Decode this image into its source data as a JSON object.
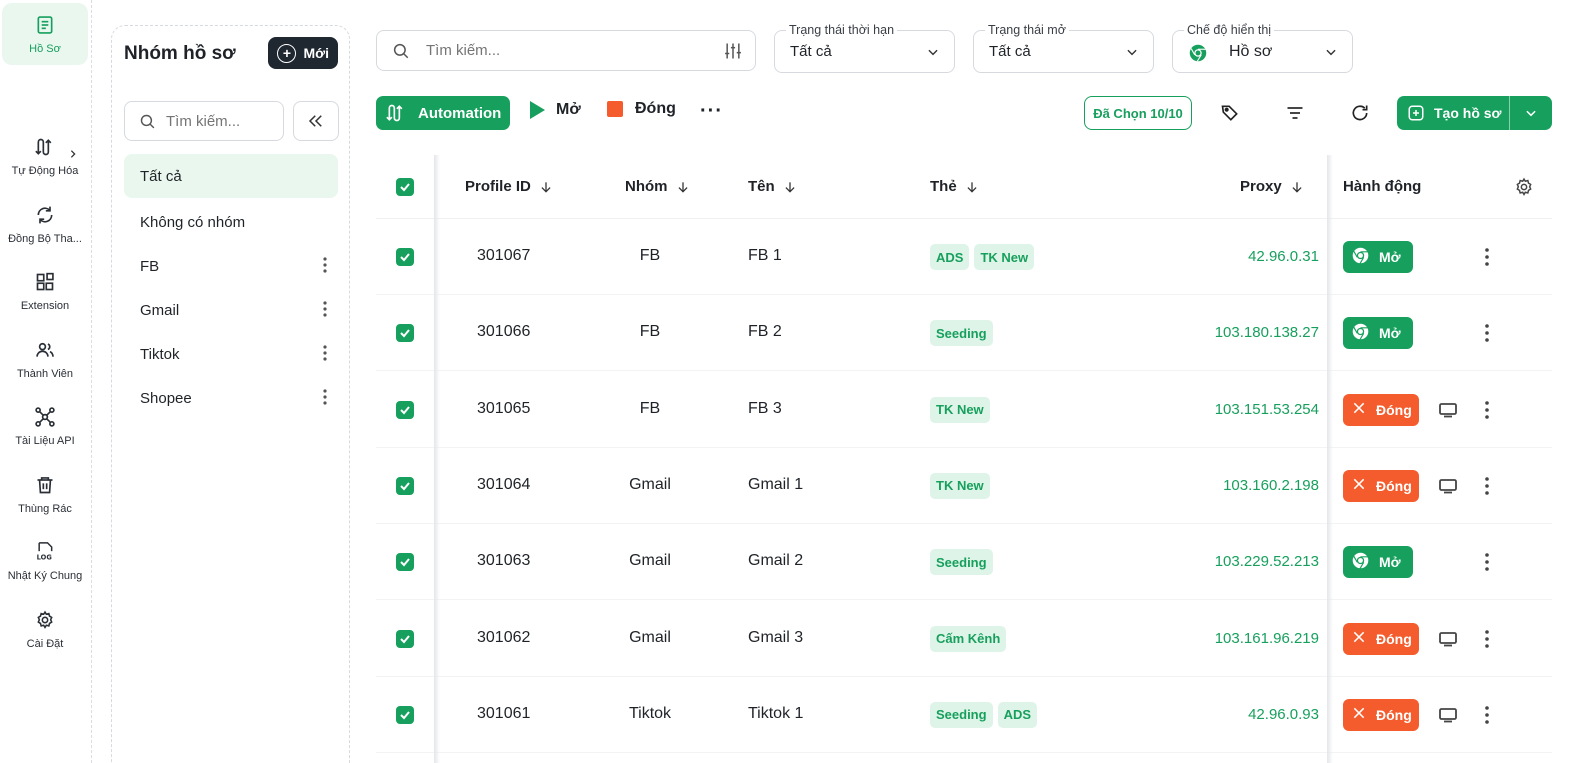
{
  "nav": [
    {
      "id": "profiles",
      "label": "Hồ Sơ",
      "icon": "document-icon",
      "active": true
    },
    {
      "id": "automation",
      "label": "Tự Động Hóa",
      "icon": "automation-icon",
      "has_submenu": true
    },
    {
      "id": "sync",
      "label": "Đồng Bộ Tha...",
      "icon": "sync-icon"
    },
    {
      "id": "extension",
      "label": "Extension",
      "icon": "extension-icon"
    },
    {
      "id": "members",
      "label": "Thành Viên",
      "icon": "members-icon"
    },
    {
      "id": "api",
      "label": "Tài Liệu API",
      "icon": "api-icon"
    },
    {
      "id": "trash",
      "label": "Thùng Rác",
      "icon": "trash-icon"
    },
    {
      "id": "log",
      "label": "Nhật Ký Chung",
      "icon": "log-icon"
    },
    {
      "id": "settings",
      "label": "Cài Đặt",
      "icon": "gear-icon"
    }
  ],
  "groups": {
    "title": "Nhóm hồ sơ",
    "new_label": "Mới",
    "search_placeholder": "Tìm kiếm...",
    "items": [
      {
        "label": "Tất cả",
        "active": true,
        "menu": false
      },
      {
        "label": "Không có nhóm",
        "menu": false
      },
      {
        "label": "FB",
        "menu": true
      },
      {
        "label": "Gmail",
        "menu": true
      },
      {
        "label": "Tiktok",
        "menu": true
      },
      {
        "label": "Shopee",
        "menu": true
      }
    ]
  },
  "toolbar": {
    "search_placeholder": "Tìm kiếm...",
    "filters": [
      {
        "caption": "Trạng thái thời hạn",
        "value": "Tất cả"
      },
      {
        "caption": "Trạng thái mở",
        "value": "Tất cả"
      },
      {
        "caption": "Chế độ hiển thị",
        "value": "Hồ sơ"
      }
    ],
    "automation_label": "Automation",
    "open_label": "Mở",
    "close_label": "Đóng",
    "more_label": "···",
    "selected_label": "Đã Chọn 10/10",
    "create_label": "Tạo hồ sơ"
  },
  "table": {
    "headers": {
      "profile_id": "Profile ID",
      "group": "Nhóm",
      "name": "Tên",
      "tags": "Thẻ",
      "proxy": "Proxy",
      "action": "Hành động"
    },
    "rows": [
      {
        "id": "301067",
        "group": "FB",
        "name": "FB 1",
        "tags": [
          "ADS",
          "TK New"
        ],
        "proxy": "42.96.0.31",
        "action": "open"
      },
      {
        "id": "301066",
        "group": "FB",
        "name": "FB 2",
        "tags": [
          "Seeding"
        ],
        "proxy": "103.180.138.27",
        "action": "open"
      },
      {
        "id": "301065",
        "group": "FB",
        "name": "FB 3",
        "tags": [
          "TK New"
        ],
        "proxy": "103.151.53.254",
        "action": "close"
      },
      {
        "id": "301064",
        "group": "Gmail",
        "name": "Gmail 1",
        "tags": [
          "TK New"
        ],
        "proxy": "103.160.2.198",
        "action": "close"
      },
      {
        "id": "301063",
        "group": "Gmail",
        "name": "Gmail 2",
        "tags": [
          "Seeding"
        ],
        "proxy": "103.229.52.213",
        "action": "open"
      },
      {
        "id": "301062",
        "group": "Gmail",
        "name": "Gmail 3",
        "tags": [
          "Cấm Kênh"
        ],
        "proxy": "103.161.96.219",
        "action": "close"
      },
      {
        "id": "301061",
        "group": "Tiktok",
        "name": "Tiktok 1",
        "tags": [
          "Seeding",
          "ADS"
        ],
        "proxy": "42.96.0.93",
        "action": "close"
      }
    ],
    "open_label": "Mở",
    "close_label": "Đóng"
  },
  "colors": {
    "brand_green": "#17a05d",
    "danger_orange": "#f45c2d",
    "dark_button": "#1f2731",
    "tag_bg": "#dff4e8"
  }
}
